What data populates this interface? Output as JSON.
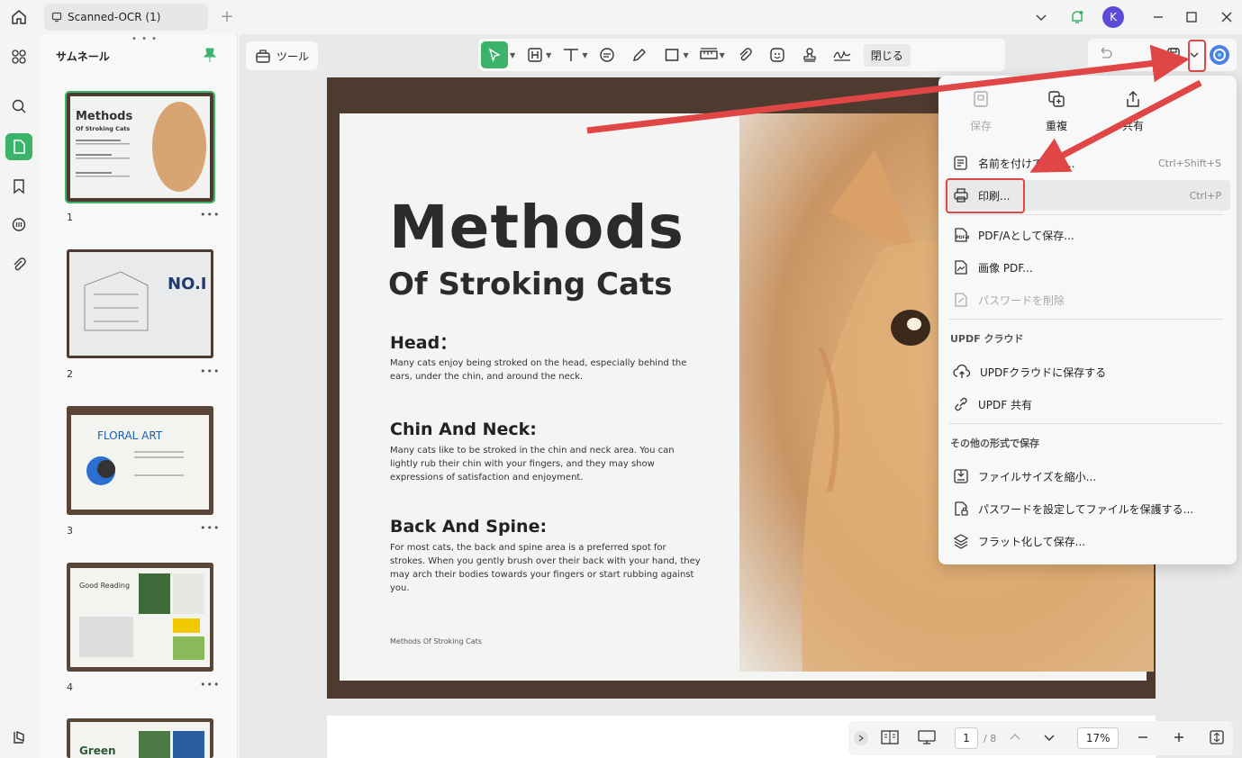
{
  "window": {
    "tab_title": "Scanned-OCR (1)",
    "user_initial": "K"
  },
  "sidebar": {
    "title": "サムネール",
    "thumbnails": [
      {
        "number": "1",
        "label": "Methods Of Stroking Cats"
      },
      {
        "number": "2",
        "label": "NO.I"
      },
      {
        "number": "3",
        "label": "FLORAL ART"
      },
      {
        "number": "4",
        "label": "Good Reading"
      },
      {
        "number": "",
        "label": "Green"
      }
    ]
  },
  "toolbar": {
    "tools_label": "ツール",
    "close_label": "閉じる"
  },
  "document": {
    "title": "Methods",
    "subtitle": "Of Stroking Cats",
    "sections": [
      {
        "heading": "Head：",
        "body": "Many cats enjoy being stroked on the head, especially behind the ears, under the chin, and around the neck."
      },
      {
        "heading": "Chin And Neck:",
        "body": "Many cats like to be stroked in the chin and neck area. You can lightly rub their chin with your fingers, and they may show expressions of satisfaction and enjoyment."
      },
      {
        "heading": "Back And Spine:",
        "body": "For most cats, the back and spine area is a preferred spot for strokes. When you gently brush over their back with your hand, they may arch their bodies towards your fingers or start rubbing against you."
      }
    ],
    "footer": "Methods Of Stroking Cats"
  },
  "pager": {
    "current_page": "1",
    "total_pages": "/ 8",
    "zoom": "17%"
  },
  "menu": {
    "quick_actions": [
      {
        "label": "保存",
        "icon": "save-icon",
        "enabled": false
      },
      {
        "label": "重複",
        "icon": "duplicate-icon",
        "enabled": true
      },
      {
        "label": "共有",
        "icon": "share-icon",
        "enabled": true
      }
    ],
    "save_as": {
      "label": "名前を付けて保存...",
      "shortcut": "Ctrl+Shift+S"
    },
    "print": {
      "label": "印刷...",
      "shortcut": "Ctrl+P"
    },
    "pdfa": {
      "label": "PDF/Aとして保存..."
    },
    "image_pdf": {
      "label": "画像 PDF..."
    },
    "remove_password": {
      "label": "パスワードを削除"
    },
    "cloud_section": "UPDF クラウド",
    "save_cloud": {
      "label": "UPDFクラウドに保存する"
    },
    "updf_share": {
      "label": "UPDF 共有"
    },
    "other_section": "その他の形式で保存",
    "reduce_size": {
      "label": "ファイルサイズを縮小..."
    },
    "protect": {
      "label": "パスワードを設定してファイルを保護する..."
    },
    "flatten": {
      "label": "フラット化して保存..."
    }
  },
  "colors": {
    "accent": "#3bb36b",
    "annotation": "#e04646"
  }
}
